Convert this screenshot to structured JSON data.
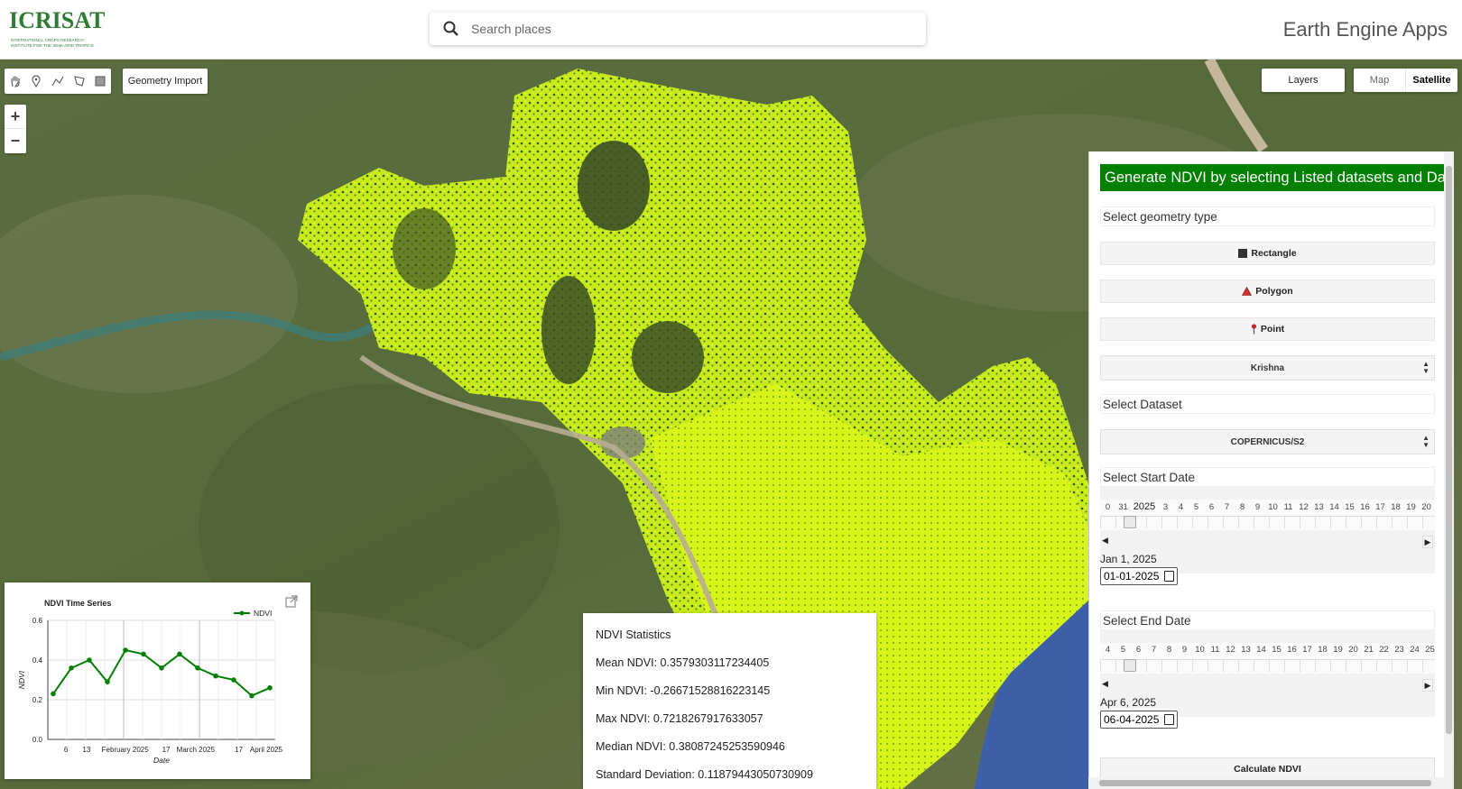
{
  "header": {
    "logo_text": "ICRISAT",
    "logo_subtext": "INTERNATIONAL CROPS RESEARCH INSTITUTE FOR THE SEMI-ARID TROPICS",
    "search_placeholder": "Search places",
    "app_title": "Earth Engine Apps"
  },
  "map_controls": {
    "draw_tools": [
      "hand-icon",
      "marker-icon",
      "line-icon",
      "polygon-icon",
      "rectangle-icon"
    ],
    "geometry_import_label": "Geometry Import",
    "zoom_in": "+",
    "zoom_out": "−",
    "layers_label": "Layers",
    "map_type_map": "Map",
    "map_type_satellite": "Satellite",
    "active_map_type": "Satellite"
  },
  "panel": {
    "title": "Generate NDVI by selecting Listed datasets and Date",
    "geometry_label": "Select geometry type",
    "buttons": {
      "rectangle": "Rectangle",
      "polygon": "Polygon",
      "point": "Point"
    },
    "region_select": "Krishna",
    "dataset_label": "Select Dataset",
    "dataset_select": "COPERNICUS/S2",
    "start_date_label": "Select Start Date",
    "start_timeline": [
      "0",
      "31",
      "2025",
      "3",
      "4",
      "5",
      "6",
      "7",
      "8",
      "9",
      "10",
      "11",
      "12",
      "13",
      "14",
      "15",
      "16",
      "17",
      "18",
      "19",
      "20"
    ],
    "start_date_text": "Jan 1, 2025",
    "start_date_value": "01-01-2025",
    "end_date_label": "Select End Date",
    "end_timeline": [
      "4",
      "5",
      "6",
      "7",
      "8",
      "9",
      "10",
      "11",
      "12",
      "13",
      "14",
      "15",
      "16",
      "17",
      "18",
      "19",
      "20",
      "21",
      "22",
      "23",
      "24",
      "25"
    ],
    "end_date_text": "Apr 6, 2025",
    "end_date_value": "06-04-2025",
    "calculate_label": "Calculate NDVI"
  },
  "colors": {
    "panel_title_bg": "#008000",
    "ndvi_line": "#008000",
    "ndvi_layer": "#c8f000",
    "polygon_icon": "#d32f2f",
    "point_icon": "#c62828"
  },
  "stats": {
    "title": "NDVI Statistics",
    "mean": "Mean NDVI: 0.3579303117234405",
    "min": "Min NDVI: -0.26671528816223145",
    "max": "Max NDVI: 0.7218267917633057",
    "median": "Median NDVI: 0.38087245253590946",
    "std": "Standard Deviation: 0.11879443050730909"
  },
  "chart_data": {
    "type": "line",
    "title": "NDVI Time Series",
    "xlabel": "Date",
    "ylabel": "NDVI",
    "ylim": [
      0.0,
      0.6
    ],
    "yticks": [
      "0.0",
      "0.2",
      "0.4",
      "0.6"
    ],
    "xticks": [
      "6",
      "13",
      "February 2025",
      "17",
      "March 2025",
      "17",
      "April 2025"
    ],
    "legend": "top-right",
    "grid": true,
    "series": [
      {
        "name": "NDVI",
        "x": [
          "2025-01-01",
          "2025-01-11",
          "2025-01-21",
          "2025-01-31",
          "2025-02-10",
          "2025-02-20",
          "2025-03-02",
          "2025-03-12",
          "2025-03-22",
          "2025-04-01",
          "2025-04-11",
          "2025-04-21"
        ],
        "values": [
          0.23,
          0.36,
          0.4,
          0.29,
          0.45,
          0.43,
          0.36,
          0.43,
          0.36,
          0.32,
          0.3,
          0.22
        ],
        "last_value": 0.26
      }
    ]
  }
}
